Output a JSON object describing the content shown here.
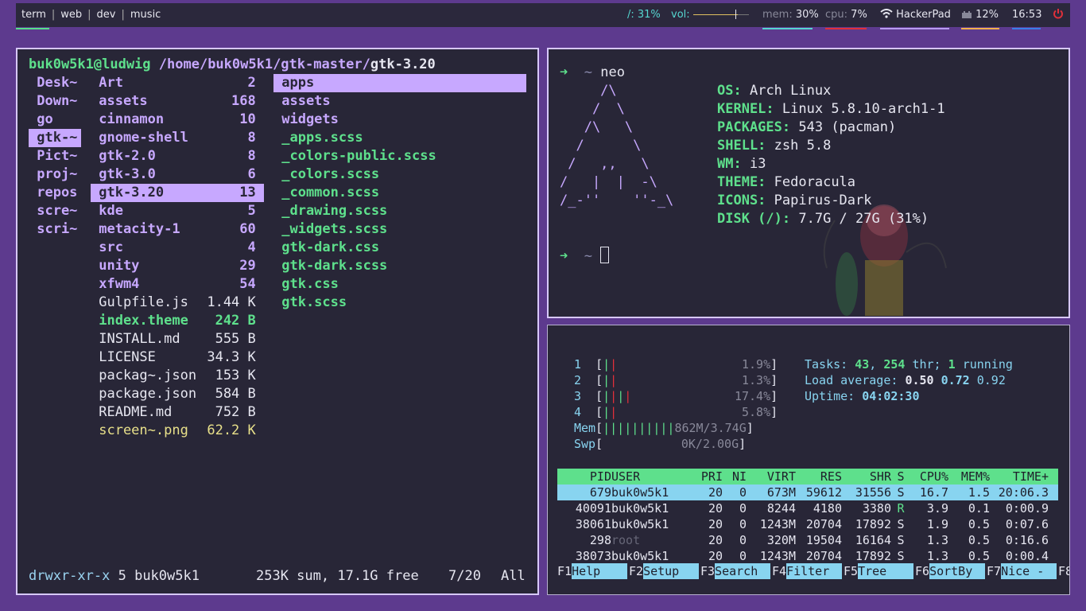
{
  "topbar": {
    "workspaces": [
      "term",
      "web",
      "dev",
      "music"
    ],
    "separator": "|",
    "disk": "/: 31%",
    "vol_label": "vol:",
    "mem_label": "mem:",
    "mem": "30%",
    "cpu_label": "cpu:",
    "cpu": "7%",
    "wifi": "HackerPad",
    "battery": "12%",
    "time": "16:53",
    "colors": {
      "mem": "#55d6d0",
      "cpu": "#e0303a",
      "wifi": "#b89cf0",
      "battery": "#f0b24a",
      "time": "#3a7ee8"
    }
  },
  "ranger": {
    "header_user": "buk0w5k1@ludwig",
    "header_path": "/home/buk0w5k1/gtk-master/",
    "header_current": "gtk-3.20",
    "col1": [
      "Desk~",
      "Down~",
      "go",
      "gtk-~",
      "Pict~",
      "proj~",
      "repos",
      "scre~",
      "scri~"
    ],
    "col2": [
      {
        "n": "Art",
        "s": "2"
      },
      {
        "n": "assets",
        "s": "168"
      },
      {
        "n": "cinnamon",
        "s": "10"
      },
      {
        "n": "gnome-shell",
        "s": "8"
      },
      {
        "n": "gtk-2.0",
        "s": "8"
      },
      {
        "n": "gtk-3.0",
        "s": "6"
      },
      {
        "n": "gtk-3.20",
        "s": "13"
      },
      {
        "n": "kde",
        "s": "5"
      },
      {
        "n": "metacity-1",
        "s": "60"
      },
      {
        "n": "src",
        "s": "4"
      },
      {
        "n": "unity",
        "s": "29"
      },
      {
        "n": "xfwm4",
        "s": "54"
      },
      {
        "n": "Gulpfile.js",
        "s": "1.44 K"
      },
      {
        "n": "index.theme",
        "s": "242 B"
      },
      {
        "n": "INSTALL.md",
        "s": "555 B"
      },
      {
        "n": "LICENSE",
        "s": "34.3 K"
      },
      {
        "n": "packag~.json",
        "s": "153 K"
      },
      {
        "n": "package.json",
        "s": "584 B"
      },
      {
        "n": "README.md",
        "s": "752 B"
      },
      {
        "n": "screen~.png",
        "s": "62.2 K"
      }
    ],
    "col3": [
      "apps",
      "assets",
      "widgets",
      "_apps.scss",
      "_colors-public.scss",
      "_colors.scss",
      "_common.scss",
      "_drawing.scss",
      "_widgets.scss",
      "gtk-dark.css",
      "gtk-dark.scss",
      "gtk.css",
      "gtk.scss"
    ],
    "status_perm": "drwxr-xr-x",
    "status_rest": "5 buk0w5k1",
    "status_sum": "253K sum, 17.1G free",
    "status_pos": "7/20",
    "status_all": "All"
  },
  "neofetch": {
    "prompt_arrow": "➜",
    "prompt_dir": "~",
    "command": "neo",
    "logo": [
      "     /\\",
      "    /  \\",
      "   /\\   \\",
      "  /      \\",
      " /   ,,   \\",
      "/   |  |  -\\",
      "/_-''    ''-_\\"
    ],
    "info": [
      {
        "k": "OS:",
        "v": "Arch Linux"
      },
      {
        "k": "KERNEL:",
        "v": "Linux 5.8.10-arch1-1"
      },
      {
        "k": "PACKAGES:",
        "v": "543 (pacman)"
      },
      {
        "k": "SHELL:",
        "v": "zsh 5.8"
      },
      {
        "k": "WM:",
        "v": "i3"
      },
      {
        "k": "THEME:",
        "v": "Fedoracula"
      },
      {
        "k": "ICONS:",
        "v": "Papirus-Dark"
      },
      {
        "k": "DISK (/):",
        "v": "7.7G / 27G (31%)"
      }
    ]
  },
  "htop": {
    "cpus": [
      {
        "n": "1",
        "bars": "||",
        "pct": "1.9%"
      },
      {
        "n": "2",
        "bars": "||",
        "pct": "1.3%"
      },
      {
        "n": "3",
        "bars": "||||",
        "pct": "17.4%"
      },
      {
        "n": "4",
        "bars": "||",
        "pct": "5.8%"
      }
    ],
    "mem_label": "Mem",
    "mem_bars": "||||||||||",
    "mem_val": "862M/3.74G",
    "swp_label": "Swp",
    "swp_val": "0K/2.00G",
    "tasks_label": "Tasks:",
    "tasks": "43",
    "thr": "254",
    "thr_label": "thr;",
    "running": "1",
    "running_label": "running",
    "load_label": "Load average:",
    "load1": "0.50",
    "load5": "0.72",
    "load15": "0.92",
    "uptime_label": "Uptime:",
    "uptime": "04:02:30",
    "headers": [
      "PID",
      "USER",
      "PRI",
      "NI",
      "VIRT",
      "RES",
      "SHR",
      "S",
      "CPU%",
      "MEM%",
      "TIME+"
    ],
    "rows": [
      [
        "679",
        "buk0w5k1",
        "20",
        "0",
        "673M",
        "59612",
        "31556",
        "S",
        "16.7",
        "1.5",
        "20:06.3"
      ],
      [
        "40091",
        "buk0w5k1",
        "20",
        "0",
        "8244",
        "4180",
        "3380",
        "R",
        "3.9",
        "0.1",
        "0:00.9"
      ],
      [
        "38061",
        "buk0w5k1",
        "20",
        "0",
        "1243M",
        "20704",
        "17892",
        "S",
        "1.9",
        "0.5",
        "0:07.6"
      ],
      [
        "298",
        "root",
        "20",
        "0",
        "320M",
        "19504",
        "16164",
        "S",
        "1.3",
        "0.5",
        "0:16.6"
      ],
      [
        "38073",
        "buk0w5k1",
        "20",
        "0",
        "1243M",
        "20704",
        "17892",
        "S",
        "1.3",
        "0.5",
        "0:00.4"
      ]
    ],
    "fkeys": [
      {
        "k": "F1",
        "l": "Help"
      },
      {
        "k": "F2",
        "l": "Setup"
      },
      {
        "k": "F3",
        "l": "Search"
      },
      {
        "k": "F4",
        "l": "Filter"
      },
      {
        "k": "F5",
        "l": "Tree"
      },
      {
        "k": "F6",
        "l": "SortBy"
      },
      {
        "k": "F7",
        "l": "Nice -"
      },
      {
        "k": "F8",
        "l": ""
      }
    ]
  }
}
